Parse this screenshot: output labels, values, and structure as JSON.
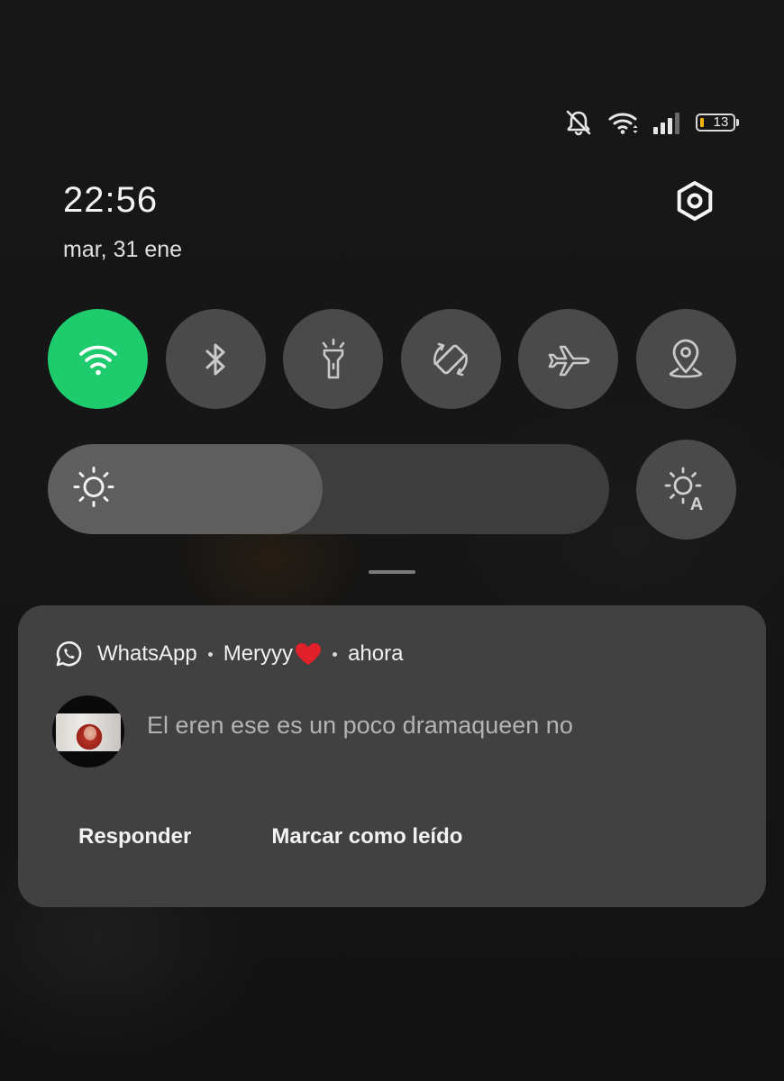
{
  "status_bar": {
    "icons": [
      "mute-icon",
      "wifi-icon",
      "signal-icon"
    ],
    "battery_level": "13",
    "battery_color": "#f5b400"
  },
  "header": {
    "time": "22:56",
    "date": "mar, 31 ene",
    "settings_icon": "settings-icon"
  },
  "quick_toggles": [
    {
      "name": "wifi",
      "icon": "wifi-icon",
      "active": true,
      "color": "#1fcc6d"
    },
    {
      "name": "bluetooth",
      "icon": "bluetooth-icon",
      "active": false
    },
    {
      "name": "flashlight",
      "icon": "flashlight-icon",
      "active": false
    },
    {
      "name": "auto-rotate",
      "icon": "rotate-icon",
      "active": false
    },
    {
      "name": "airplane-mode",
      "icon": "airplane-icon",
      "active": false
    },
    {
      "name": "location",
      "icon": "location-icon",
      "active": false
    }
  ],
  "brightness": {
    "level": 0.49,
    "icon": "sun-icon",
    "auto_icon": "auto-brightness-icon"
  },
  "notification": {
    "app_name": "WhatsApp",
    "sender": "Meryyy",
    "time": "ahora",
    "message": "El eren ese es un poco dramaqueen no",
    "actions": {
      "reply": "Responder",
      "mark_read": "Marcar como leído"
    }
  }
}
